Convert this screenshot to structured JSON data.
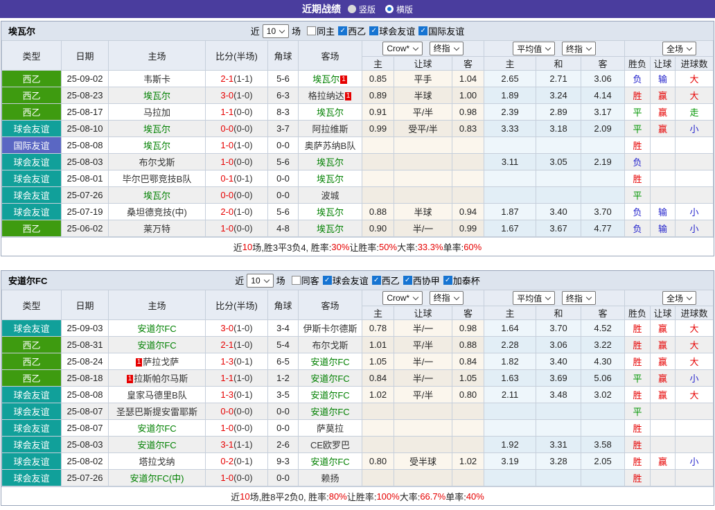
{
  "title_bar": {
    "title": "近期战绩",
    "radios": [
      {
        "label": "竖版",
        "selected": false
      },
      {
        "label": "横版",
        "selected": true
      }
    ]
  },
  "labels": {
    "near": "近",
    "matches": "场"
  },
  "columns": {
    "type": "类型",
    "date": "日期",
    "home": "主场",
    "score": "比分(半场)",
    "corner": "角球",
    "away": "客场",
    "sub": [
      "主",
      "让球",
      "客",
      "主",
      "和",
      "客",
      "胜负",
      "让球",
      "进球数"
    ]
  },
  "selects": {
    "book": "Crow*",
    "final1": "终指",
    "avg": "平均值",
    "final2": "终指",
    "fulltime": "全场"
  },
  "colors": {
    "topbar": "#4a3d9e",
    "focal_team": "#008000",
    "score": "#e60000",
    "checkbox": "#1674d2",
    "rank_badge": "#e60000"
  },
  "type_colors": {
    "西乙": "#3e9b10",
    "球会友谊": "#11a09a",
    "国际友谊": "#5a67c3"
  },
  "result_colors": {
    "r": "#e60000",
    "g": "#009500",
    "b": "#2424cc"
  },
  "sections": [
    {
      "team": "埃瓦尔",
      "count": "10",
      "filters": [
        {
          "label": "同主",
          "checked": false
        },
        {
          "label": "西乙",
          "checked": true
        },
        {
          "label": "球会友谊",
          "checked": true
        },
        {
          "label": "国际友谊",
          "checked": true
        }
      ],
      "rows": [
        {
          "type": "西乙",
          "date": "25-09-02",
          "home": {
            "name": "韦斯卡"
          },
          "score": "2-1",
          "half": "(1-1)",
          "corner": "5-6",
          "away": {
            "name": "埃瓦尔",
            "focal": true,
            "rank": "1",
            "rank_pos": "after"
          },
          "o1": [
            "0.85",
            "平手",
            "1.04"
          ],
          "o2": [
            "2.65",
            "2.71",
            "3.06"
          ],
          "res": [
            "负",
            "b"
          ],
          "han": [
            "输",
            "b"
          ],
          "goal": [
            "大",
            "r"
          ]
        },
        {
          "type": "西乙",
          "date": "25-08-23",
          "home": {
            "name": "埃瓦尔",
            "focal": true
          },
          "score": "3-0",
          "half": "(1-0)",
          "corner": "6-3",
          "away": {
            "name": "格拉纳达",
            "rank": "1",
            "rank_pos": "after"
          },
          "o1": [
            "0.89",
            "半球",
            "1.00"
          ],
          "o2": [
            "1.89",
            "3.24",
            "4.14"
          ],
          "res": [
            "胜",
            "r"
          ],
          "han": [
            "赢",
            "r"
          ],
          "goal": [
            "大",
            "r"
          ]
        },
        {
          "type": "西乙",
          "date": "25-08-17",
          "home": {
            "name": "马拉加"
          },
          "score": "1-1",
          "half": "(0-0)",
          "corner": "8-3",
          "away": {
            "name": "埃瓦尔",
            "focal": true
          },
          "o1": [
            "0.91",
            "平/半",
            "0.98"
          ],
          "o2": [
            "2.39",
            "2.89",
            "3.17"
          ],
          "res": [
            "平",
            "g"
          ],
          "han": [
            "赢",
            "r"
          ],
          "goal": [
            "走",
            "g"
          ]
        },
        {
          "type": "球会友谊",
          "date": "25-08-10",
          "home": {
            "name": "埃瓦尔",
            "focal": true
          },
          "score": "0-0",
          "half": "(0-0)",
          "corner": "3-7",
          "away": {
            "name": "阿拉维斯"
          },
          "o1": [
            "0.99",
            "受平/半",
            "0.83"
          ],
          "o2": [
            "3.33",
            "3.18",
            "2.09"
          ],
          "res": [
            "平",
            "g"
          ],
          "han": [
            "赢",
            "r"
          ],
          "goal": [
            "小",
            "b"
          ]
        },
        {
          "type": "国际友谊",
          "date": "25-08-08",
          "home": {
            "name": "埃瓦尔",
            "focal": true
          },
          "score": "1-0",
          "half": "(1-0)",
          "corner": "0-0",
          "away": {
            "name": "奥萨苏纳B队"
          },
          "o1": null,
          "o2": null,
          "res": [
            "胜",
            "r"
          ],
          "han": null,
          "goal": null
        },
        {
          "type": "球会友谊",
          "date": "25-08-03",
          "home": {
            "name": "布尔戈斯"
          },
          "score": "1-0",
          "half": "(0-0)",
          "corner": "5-6",
          "away": {
            "name": "埃瓦尔",
            "focal": true
          },
          "o1": null,
          "o2": [
            "3.11",
            "3.05",
            "2.19"
          ],
          "res": [
            "负",
            "b"
          ],
          "han": null,
          "goal": null
        },
        {
          "type": "球会友谊",
          "date": "25-08-01",
          "home": {
            "name": "毕尔巴鄂竞技B队"
          },
          "score": "0-1",
          "half": "(0-1)",
          "corner": "0-0",
          "away": {
            "name": "埃瓦尔",
            "focal": true
          },
          "o1": null,
          "o2": null,
          "res": [
            "胜",
            "r"
          ],
          "han": null,
          "goal": null
        },
        {
          "type": "球会友谊",
          "date": "25-07-26",
          "home": {
            "name": "埃瓦尔",
            "focal": true
          },
          "score": "0-0",
          "half": "(0-0)",
          "corner": "0-0",
          "away": {
            "name": "波城"
          },
          "o1": null,
          "o2": null,
          "res": [
            "平",
            "g"
          ],
          "han": null,
          "goal": null
        },
        {
          "type": "球会友谊",
          "date": "25-07-19",
          "home": {
            "name": "桑坦德竞技(中)"
          },
          "score": "2-0",
          "half": "(1-0)",
          "corner": "5-6",
          "away": {
            "name": "埃瓦尔",
            "focal": true
          },
          "o1": [
            "0.88",
            "半球",
            "0.94"
          ],
          "o2": [
            "1.87",
            "3.40",
            "3.70"
          ],
          "res": [
            "负",
            "b"
          ],
          "han": [
            "输",
            "b"
          ],
          "goal": [
            "小",
            "b"
          ]
        },
        {
          "type": "西乙",
          "date": "25-06-02",
          "home": {
            "name": "莱万特"
          },
          "score": "1-0",
          "half": "(0-0)",
          "corner": "4-8",
          "away": {
            "name": "埃瓦尔",
            "focal": true
          },
          "o1": [
            "0.90",
            "半/一",
            "0.99"
          ],
          "o2": [
            "1.67",
            "3.67",
            "4.77"
          ],
          "res": [
            "负",
            "b"
          ],
          "han": [
            "输",
            "b"
          ],
          "goal": [
            "小",
            "b"
          ]
        }
      ],
      "summary": [
        {
          "t": "近"
        },
        {
          "t": "10",
          "red": true
        },
        {
          "t": "场,胜3平3负4, 胜率:"
        },
        {
          "t": "30%",
          "red": true
        },
        {
          "t": " 让胜率:"
        },
        {
          "t": "50%",
          "red": true
        },
        {
          "t": " 大率:"
        },
        {
          "t": "33.3%",
          "red": true
        },
        {
          "t": " 单率:"
        },
        {
          "t": "60%",
          "red": true
        }
      ]
    },
    {
      "team": "安道尔FC",
      "count": "10",
      "filters": [
        {
          "label": "同客",
          "checked": false
        },
        {
          "label": "球会友谊",
          "checked": true
        },
        {
          "label": "西乙",
          "checked": true
        },
        {
          "label": "西协甲",
          "checked": true
        },
        {
          "label": "加泰杯",
          "checked": true
        }
      ],
      "rows": [
        {
          "type": "球会友谊",
          "date": "25-09-03",
          "home": {
            "name": "安道尔FC",
            "focal": true
          },
          "score": "3-0",
          "half": "(1-0)",
          "corner": "3-4",
          "away": {
            "name": "伊斯卡尔德斯"
          },
          "o1": [
            "0.78",
            "半/一",
            "0.98"
          ],
          "o2": [
            "1.64",
            "3.70",
            "4.52"
          ],
          "res": [
            "胜",
            "r"
          ],
          "han": [
            "赢",
            "r"
          ],
          "goal": [
            "大",
            "r"
          ]
        },
        {
          "type": "西乙",
          "date": "25-08-31",
          "home": {
            "name": "安道尔FC",
            "focal": true
          },
          "score": "2-1",
          "half": "(1-0)",
          "corner": "5-4",
          "away": {
            "name": "布尔戈斯"
          },
          "o1": [
            "1.01",
            "平/半",
            "0.88"
          ],
          "o2": [
            "2.28",
            "3.06",
            "3.22"
          ],
          "res": [
            "胜",
            "r"
          ],
          "han": [
            "赢",
            "r"
          ],
          "goal": [
            "大",
            "r"
          ]
        },
        {
          "type": "西乙",
          "date": "25-08-24",
          "home": {
            "name": "萨拉戈萨",
            "rank": "1",
            "rank_pos": "before"
          },
          "score": "1-3",
          "half": "(0-1)",
          "corner": "6-5",
          "away": {
            "name": "安道尔FC",
            "focal": true
          },
          "o1": [
            "1.05",
            "半/一",
            "0.84"
          ],
          "o2": [
            "1.82",
            "3.40",
            "4.30"
          ],
          "res": [
            "胜",
            "r"
          ],
          "han": [
            "赢",
            "r"
          ],
          "goal": [
            "大",
            "r"
          ]
        },
        {
          "type": "西乙",
          "date": "25-08-18",
          "home": {
            "name": "拉斯帕尔马斯",
            "rank": "1",
            "rank_pos": "before"
          },
          "score": "1-1",
          "half": "(1-0)",
          "corner": "1-2",
          "away": {
            "name": "安道尔FC",
            "focal": true
          },
          "o1": [
            "0.84",
            "半/一",
            "1.05"
          ],
          "o2": [
            "1.63",
            "3.69",
            "5.06"
          ],
          "res": [
            "平",
            "g"
          ],
          "han": [
            "赢",
            "r"
          ],
          "goal": [
            "小",
            "b"
          ]
        },
        {
          "type": "球会友谊",
          "date": "25-08-08",
          "home": {
            "name": "皇家马德里B队"
          },
          "score": "1-3",
          "half": "(0-1)",
          "corner": "3-5",
          "away": {
            "name": "安道尔FC",
            "focal": true
          },
          "o1": [
            "1.02",
            "平/半",
            "0.80"
          ],
          "o2": [
            "2.11",
            "3.48",
            "3.02"
          ],
          "res": [
            "胜",
            "r"
          ],
          "han": [
            "赢",
            "r"
          ],
          "goal": [
            "大",
            "r"
          ]
        },
        {
          "type": "球会友谊",
          "date": "25-08-07",
          "home": {
            "name": "圣瑟巴斯提安雷耶斯"
          },
          "score": "0-0",
          "half": "(0-0)",
          "corner": "0-0",
          "away": {
            "name": "安道尔FC",
            "focal": true
          },
          "o1": null,
          "o2": null,
          "res": [
            "平",
            "g"
          ],
          "han": null,
          "goal": null
        },
        {
          "type": "球会友谊",
          "date": "25-08-07",
          "home": {
            "name": "安道尔FC",
            "focal": true
          },
          "score": "1-0",
          "half": "(0-0)",
          "corner": "0-0",
          "away": {
            "name": "萨莫拉"
          },
          "o1": null,
          "o2": null,
          "res": [
            "胜",
            "r"
          ],
          "han": null,
          "goal": null
        },
        {
          "type": "球会友谊",
          "date": "25-08-03",
          "home": {
            "name": "安道尔FC",
            "focal": true
          },
          "score": "3-1",
          "half": "(1-1)",
          "corner": "2-6",
          "away": {
            "name": "CE欧罗巴"
          },
          "o1": null,
          "o2": [
            "1.92",
            "3.31",
            "3.58"
          ],
          "res": [
            "胜",
            "r"
          ],
          "han": null,
          "goal": null
        },
        {
          "type": "球会友谊",
          "date": "25-08-02",
          "home": {
            "name": "塔拉戈纳"
          },
          "score": "0-2",
          "half": "(0-1)",
          "corner": "9-3",
          "away": {
            "name": "安道尔FC",
            "focal": true
          },
          "o1": [
            "0.80",
            "受半球",
            "1.02"
          ],
          "o2": [
            "3.19",
            "3.28",
            "2.05"
          ],
          "res": [
            "胜",
            "r"
          ],
          "han": [
            "赢",
            "r"
          ],
          "goal": [
            "小",
            "b"
          ]
        },
        {
          "type": "球会友谊",
          "date": "25-07-26",
          "home": {
            "name": "安道尔FC(中)",
            "focal": true
          },
          "score": "1-0",
          "half": "(0-0)",
          "corner": "0-0",
          "away": {
            "name": "赖扬"
          },
          "o1": null,
          "o2": null,
          "res": [
            "胜",
            "r"
          ],
          "han": null,
          "goal": null
        }
      ],
      "summary": [
        {
          "t": "近"
        },
        {
          "t": "10",
          "red": true
        },
        {
          "t": "场,胜8平2负0, 胜率:"
        },
        {
          "t": "80%",
          "red": true
        },
        {
          "t": " 让胜率:"
        },
        {
          "t": "100%",
          "red": true
        },
        {
          "t": " 大率:"
        },
        {
          "t": "66.7%",
          "red": true
        },
        {
          "t": " 单率:"
        },
        {
          "t": "40%",
          "red": true
        }
      ]
    }
  ]
}
